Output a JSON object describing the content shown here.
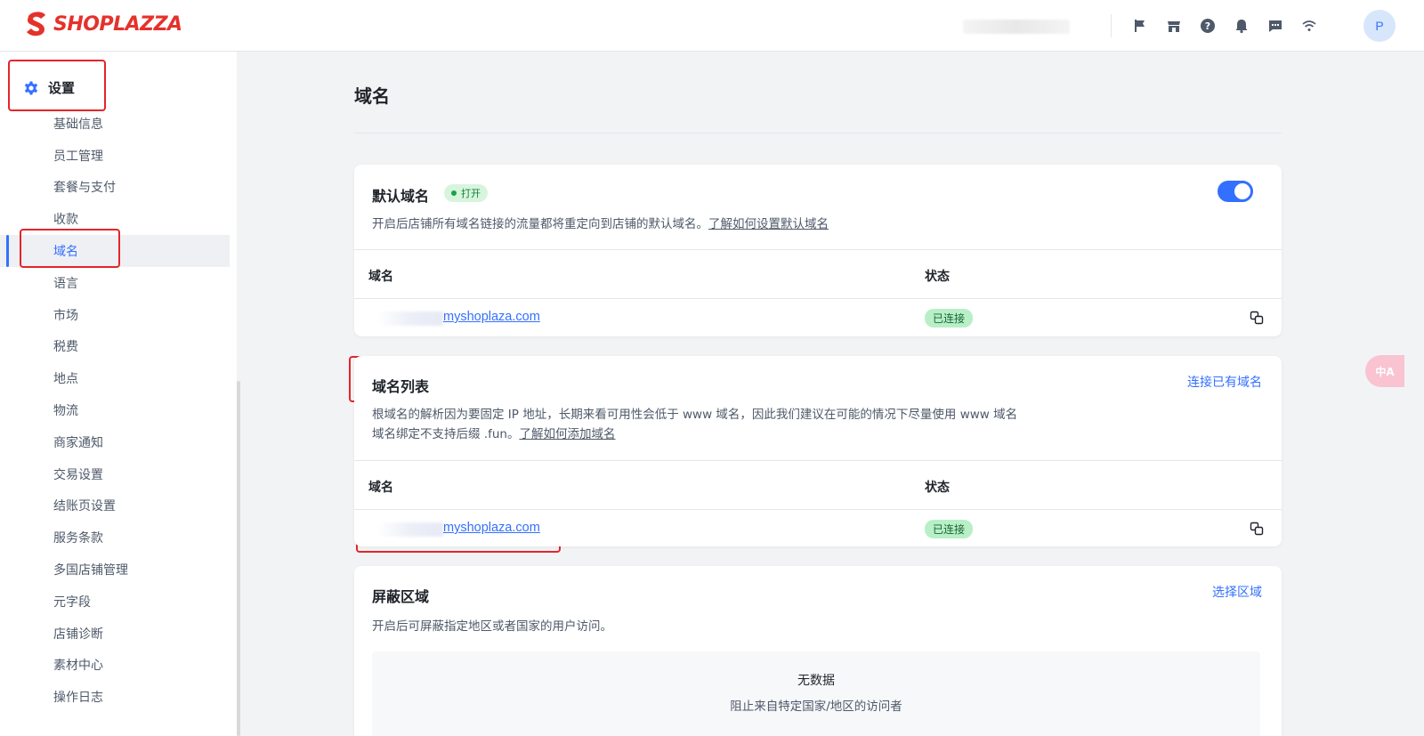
{
  "app": {
    "logo_text": "SHOPLAZZA",
    "brand_color": "#e4322b",
    "accent_color": "#3370ff",
    "avatar_initial": "P",
    "top_icons": [
      "flag-icon",
      "store-icon",
      "help-icon",
      "bell-icon",
      "message-icon",
      "wifi-icon"
    ]
  },
  "sidebar": {
    "header_label": "设置",
    "header_icon": "gear-icon",
    "items": [
      {
        "label": "基础信息"
      },
      {
        "label": "员工管理"
      },
      {
        "label": "套餐与支付"
      },
      {
        "label": "收款"
      },
      {
        "label": "域名",
        "active": true
      },
      {
        "label": "语言"
      },
      {
        "label": "市场"
      },
      {
        "label": "税费"
      },
      {
        "label": "地点"
      },
      {
        "label": "物流"
      },
      {
        "label": "商家通知"
      },
      {
        "label": "交易设置"
      },
      {
        "label": "结账页设置"
      },
      {
        "label": "服务条款"
      },
      {
        "label": "多国店铺管理"
      },
      {
        "label": "元字段"
      },
      {
        "label": "店铺诊断"
      },
      {
        "label": "素材中心"
      },
      {
        "label": "操作日志"
      }
    ]
  },
  "page": {
    "title": "域名"
  },
  "default_domain": {
    "title": "默认域名",
    "badge": "打开",
    "toggle_on": true,
    "desc": "开启后店铺所有域名链接的流量都将重定向到店铺的默认域名。",
    "desc_link": "了解如何设置默认域名",
    "col_domain": "域名",
    "col_status": "状态",
    "row_domain": "myshoplaza.com",
    "row_status": "已连接"
  },
  "domain_list": {
    "title": "域名列表",
    "action": "连接已有域名",
    "desc_line1": "根域名的解析因为要固定 IP 地址，长期来看可用性会低于 www 域名，因此我们建议在可能的情况下尽量使用 www 域名",
    "desc_line2": "域名绑定不支持后缀 .fun。",
    "desc_link": "了解如何添加域名",
    "col_domain": "域名",
    "col_status": "状态",
    "row_domain": "myshoplaza.com",
    "row_status": "已连接"
  },
  "blocked_region": {
    "title": "屏蔽区域",
    "action": "选择区域",
    "desc": "开启后可屏蔽指定地区或者国家的用户访问。",
    "empty_title": "无数据",
    "empty_sub": "阻止来自特定国家/地区的访问者"
  },
  "translate_fab": "中A"
}
